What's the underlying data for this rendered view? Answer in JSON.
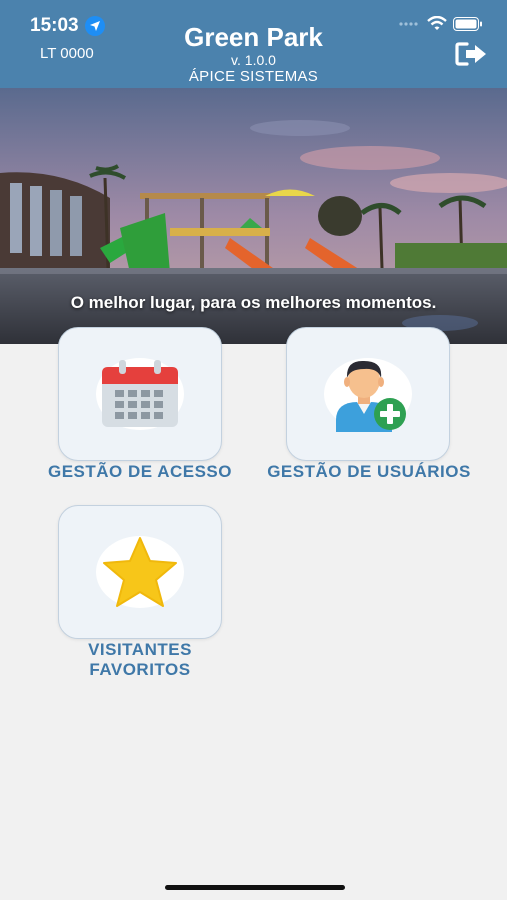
{
  "status_bar": {
    "time": "15:03"
  },
  "header": {
    "lot_label": "LT 0000",
    "title": "Green Park",
    "version": "v. 1.0.0",
    "company": "ÁPICE SISTEMAS"
  },
  "banner": {
    "caption": "O melhor lugar, para os melhores momentos."
  },
  "menu": {
    "items": [
      {
        "label": "GESTÃO DE ACESSO",
        "icon": "calendar-icon"
      },
      {
        "label": "GESTÃO DE USUÁRIOS",
        "icon": "add-user-icon"
      },
      {
        "label_line1": "VISITANTES",
        "label_line2": "FAVORITOS",
        "icon": "star-icon"
      }
    ]
  },
  "colors": {
    "header_bg": "#4b82ad",
    "tile_bg": "#eef3f8",
    "label_text": "#3f78a8",
    "page_bg": "#f1f1f1"
  }
}
